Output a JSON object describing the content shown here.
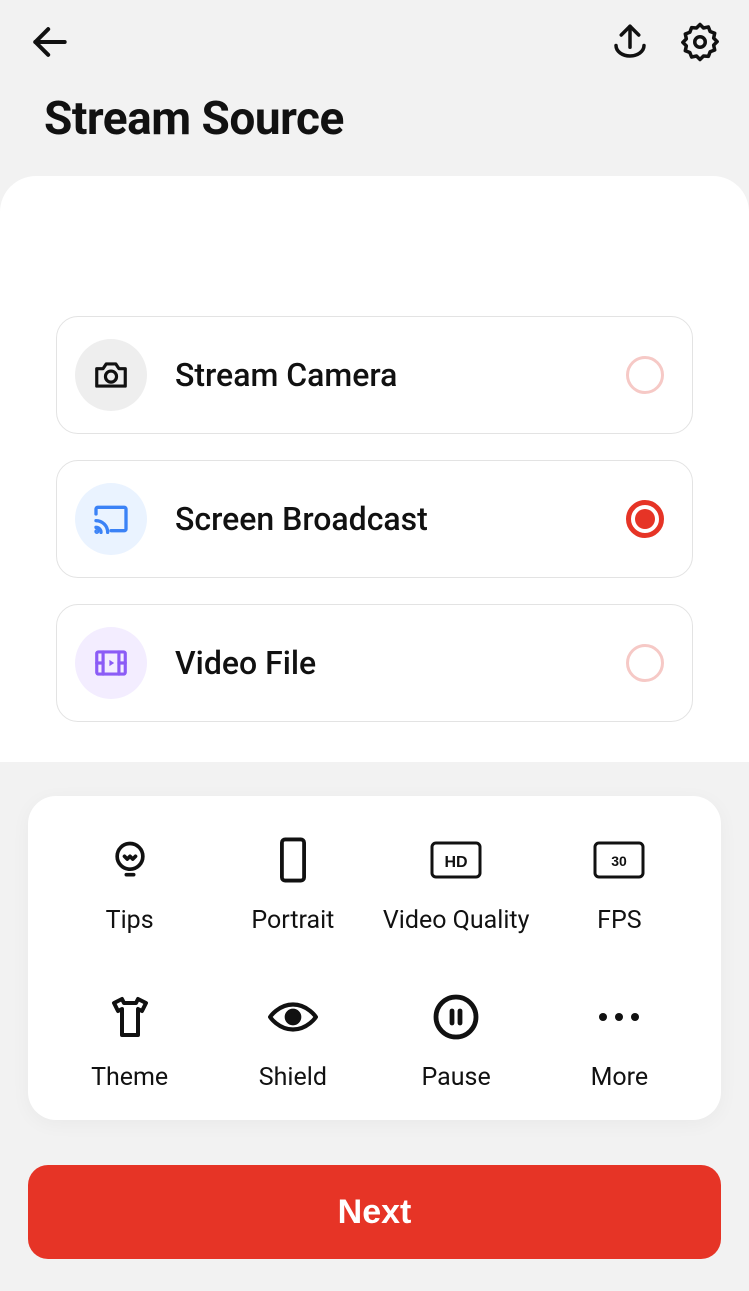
{
  "title": "Stream Source",
  "options": [
    {
      "label": "Stream Camera",
      "selected": false
    },
    {
      "label": "Screen Broadcast",
      "selected": true
    },
    {
      "label": "Video File",
      "selected": false
    }
  ],
  "settings": [
    {
      "label": "Tips"
    },
    {
      "label": "Portrait"
    },
    {
      "label": "Video Quality",
      "badge": "HD"
    },
    {
      "label": "FPS",
      "badge": "30"
    },
    {
      "label": "Theme"
    },
    {
      "label": "Shield"
    },
    {
      "label": "Pause"
    },
    {
      "label": "More"
    }
  ],
  "next_label": "Next"
}
